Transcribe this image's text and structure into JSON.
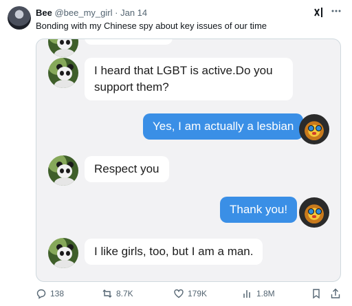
{
  "tweet": {
    "author_name": "Bee",
    "author_handle": "@bee_my_girl",
    "separator": "·",
    "date": "Jan 14",
    "text": "Bonding with my Chinese spy about key issues of our time"
  },
  "chat": {
    "messages": [
      {
        "side": "left",
        "text": "I heard that LGBT is active.Do you"
      },
      {
        "side": "left",
        "text": "support them?"
      },
      {
        "side": "right",
        "text": "Yes, I am actually a lesbian"
      },
      {
        "side": "left",
        "text": "Respect you"
      },
      {
        "side": "right",
        "text": "Thank you!"
      },
      {
        "side": "left",
        "text": "I like girls, too, but I am a man."
      }
    ]
  },
  "actions": {
    "replies": "138",
    "reposts": "8.7K",
    "likes": "179K",
    "views": "1.8M"
  },
  "icons": {
    "grok": "grok-icon",
    "more": "more-icon",
    "reply": "reply-icon",
    "repost": "repost-icon",
    "like": "heart-icon",
    "views": "views-icon",
    "bookmark": "bookmark-icon",
    "share": "share-icon"
  },
  "colors": {
    "accent_bubble": "#3a8fe6",
    "left_bubble": "#ffffff",
    "chat_background": "#f2f2f4",
    "muted_text": "#536471"
  }
}
